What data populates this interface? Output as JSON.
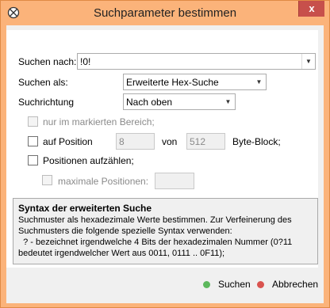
{
  "window": {
    "title": "Suchparameter bestimmen",
    "close_glyph": "x"
  },
  "colors": {
    "title_bar": "#fbb37a",
    "close_button": "#c7504b",
    "search_dot": "#5cb85c",
    "cancel_dot": "#d9534f"
  },
  "form": {
    "search_for": {
      "label": "Suchen nach:",
      "value": "!0!"
    },
    "search_as": {
      "label": "Suchen als:",
      "value": "Erweiterte Hex-Suche"
    },
    "direction": {
      "label": "Suchrichtung",
      "value": "Nach oben"
    },
    "only_selection": {
      "label": "nur im markierten Bereich;",
      "checked": false
    },
    "at_position": {
      "label": "auf Position",
      "position_value": "8",
      "of_label": "von",
      "block_value": "512",
      "block_label": "Byte-Block;",
      "checked": false
    },
    "enumerate": {
      "label": "Positionen aufzählen;",
      "checked": false
    },
    "max_positions": {
      "label": "maximale Positionen:",
      "value": "",
      "checked": false
    }
  },
  "help": {
    "title": "Syntax der erweiterten Suche",
    "lines": [
      "Suchmuster als hexadezimale Werte bestimmen. Zur Verfeinerung des",
      "Suchmusters die folgende spezielle Syntax verwenden:",
      "  ? - bezeichnet irgendwelche 4 Bits der hexadezimalen Nummer (0?11",
      "bedeutet irgendwelcher Wert aus 0011, 0111 .. 0F11);"
    ]
  },
  "buttons": {
    "search": "Suchen",
    "cancel": "Abbrechen"
  },
  "icons": {
    "app": "crosshair-circle-icon",
    "dropdown": "chevron-down-icon"
  }
}
